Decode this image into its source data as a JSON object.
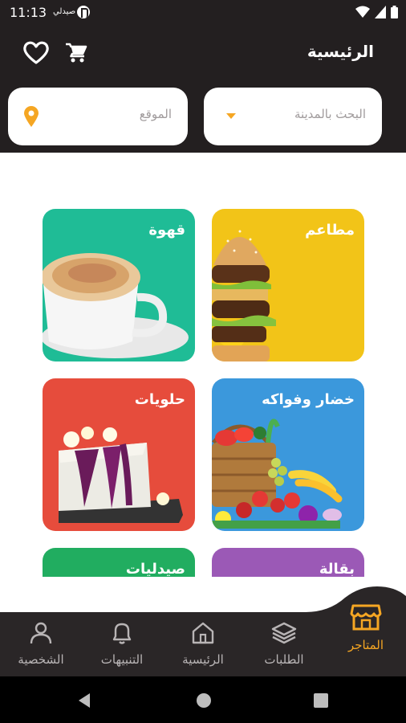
{
  "status_bar": {
    "time": "11:13",
    "small_label": "صيدلي"
  },
  "header": {
    "title": "الرئيسية",
    "city_search_placeholder": "البحث بالمدينة",
    "location_placeholder": "الموقع"
  },
  "categories": [
    {
      "label": "مطاعم",
      "color": "#f2c418"
    },
    {
      "label": "قهوة",
      "color": "#1fbc96"
    },
    {
      "label": "خضار وفواكه",
      "color": "#3b98dc"
    },
    {
      "label": "حلويات",
      "color": "#e64c3c"
    },
    {
      "label": "بقالة",
      "color": "#9b59b6"
    },
    {
      "label": "صيدليات",
      "color": "#21ad60"
    }
  ],
  "bottom_nav": {
    "items": [
      {
        "label": "المتاجر",
        "icon": "store-icon",
        "active": true
      },
      {
        "label": "الطلبات",
        "icon": "layers-icon"
      },
      {
        "label": "الرئيسية",
        "icon": "home-icon"
      },
      {
        "label": "التنبيهات",
        "icon": "bell-icon"
      },
      {
        "label": "الشخصية",
        "icon": "person-icon"
      }
    ]
  },
  "colors": {
    "dark": "#231f20",
    "accent": "#f5a623"
  }
}
